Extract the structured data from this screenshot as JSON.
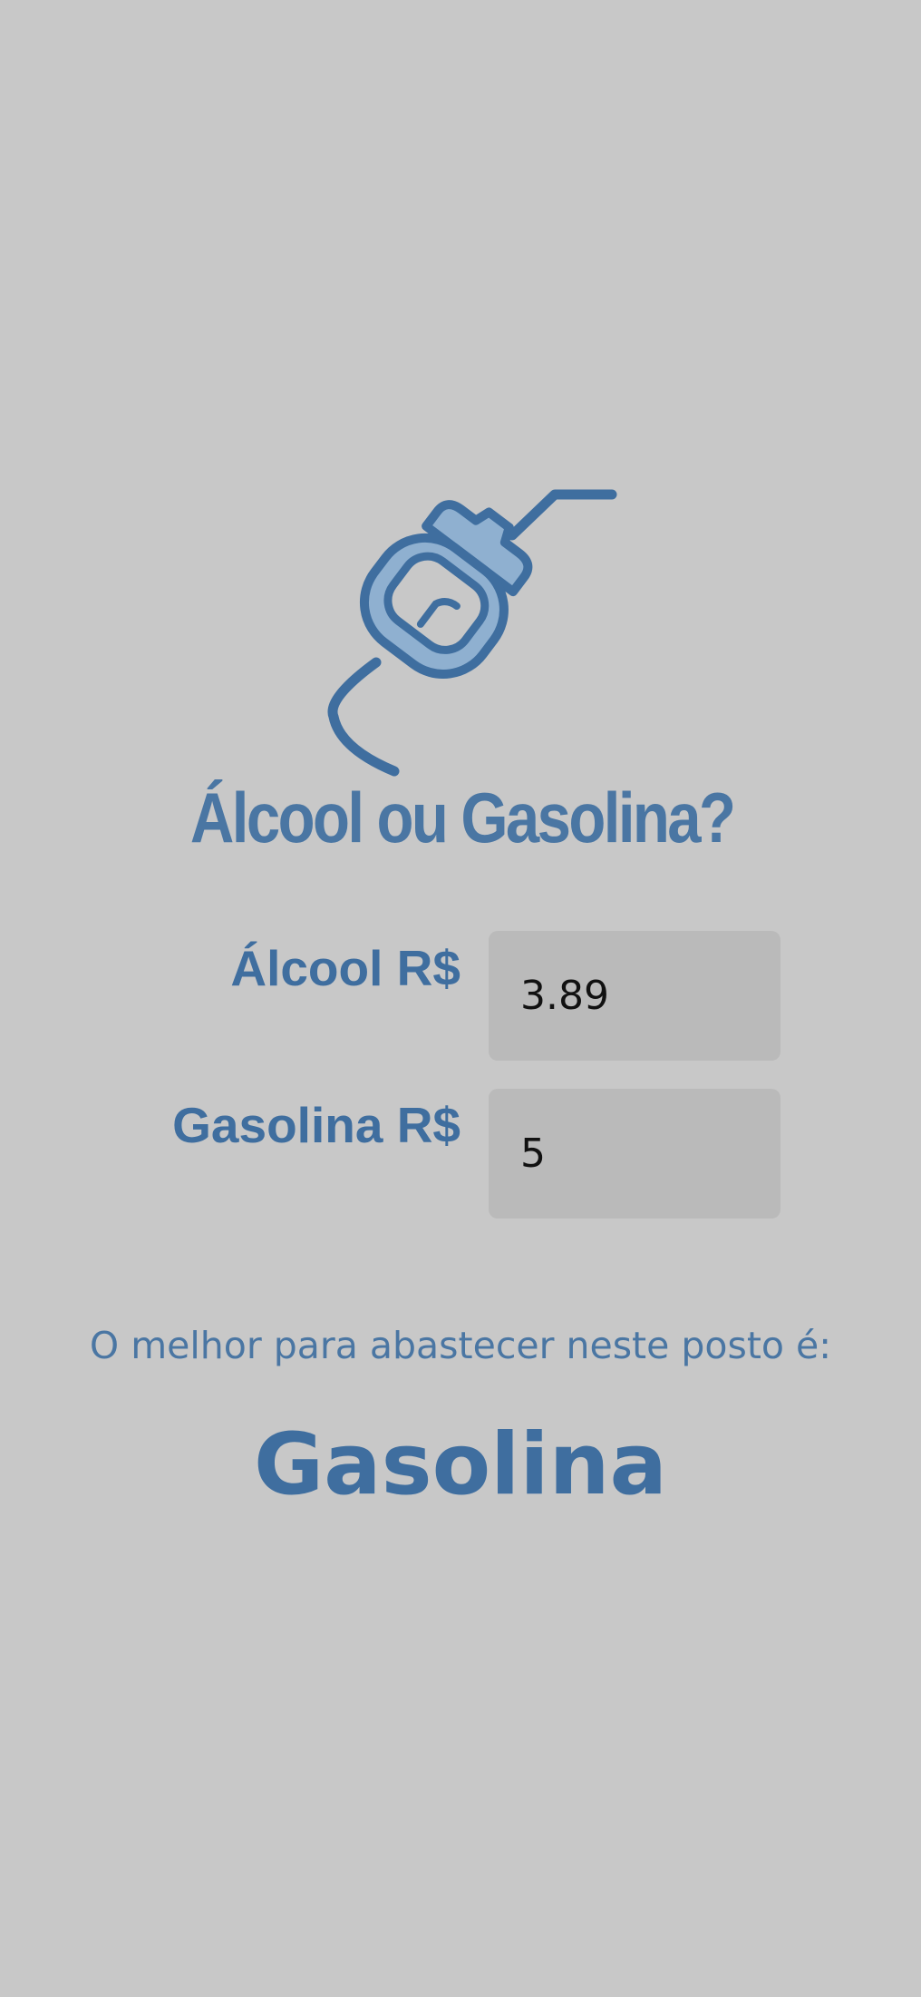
{
  "header": {
    "title": "Álcool ou Gasolina?",
    "logo_icon": "fuel-pump-nozzle-icon"
  },
  "form": {
    "alcohol": {
      "label": "Álcool R$",
      "value": "3.89"
    },
    "gasoline": {
      "label": "Gasolina R$",
      "value": "5"
    }
  },
  "result": {
    "caption": "O melhor para abastecer neste posto é:",
    "value": "Gasolina"
  },
  "colors": {
    "background": "#c8c8c8",
    "primary": "#4a76a3",
    "input_background": "#bababa",
    "icon_fill": "#8fb0d0"
  }
}
